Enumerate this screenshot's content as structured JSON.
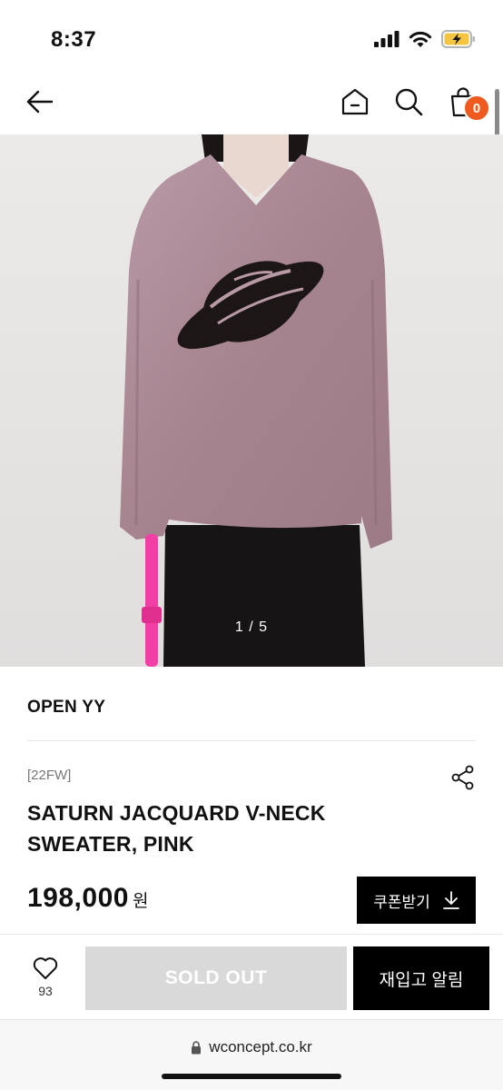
{
  "status_bar": {
    "time": "8:37",
    "icons": [
      "signal-icon",
      "wifi-icon",
      "battery-charging-icon"
    ],
    "battery_color": "#f5c542"
  },
  "nav": {
    "back_icon": "back-arrow-icon",
    "home_icon": "home-icon",
    "search_icon": "search-icon",
    "cart_icon": "shopping-bag-icon",
    "cart_count": "0",
    "badge_color": "#ef5a1f"
  },
  "gallery": {
    "counter": "1 / 5"
  },
  "product": {
    "brand": "OPEN YY",
    "season": "[22FW]",
    "title": "SATURN JACQUARD V-NECK SWEATER, PINK",
    "price": "198,000",
    "currency": "원",
    "share_icon": "share-icon"
  },
  "buttons": {
    "coupon_label": "쿠폰받기",
    "coupon_icon": "download-icon",
    "wish_icon": "heart-icon",
    "wish_count": "93",
    "soldout_label": "SOLD OUT",
    "restock_label": "재입고 알림"
  },
  "browser": {
    "lock_icon": "lock-icon",
    "url": "wconcept.co.kr"
  }
}
